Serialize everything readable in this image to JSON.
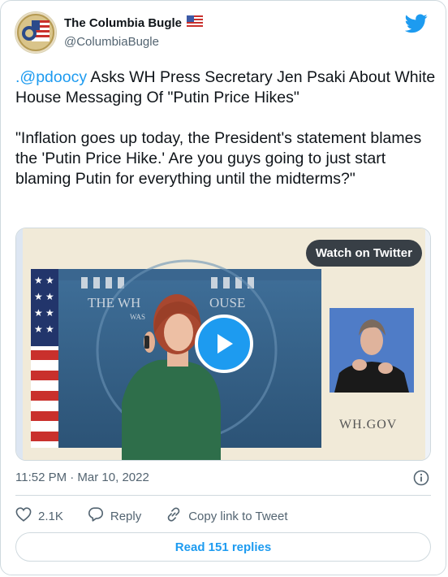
{
  "author": {
    "name": "The Columbia Bugle",
    "flag_icon": "us-flag-icon",
    "handle": "@ColumbiaBugle",
    "avatar_icon": "columbia-bugle-logo"
  },
  "brand_icon": "twitter-bird-icon",
  "tweet": {
    "mention": ".@pdoocy",
    "line1_rest": " Asks WH Press Secretary Jen Psaki About White House Messaging Of \"Putin Price Hikes\"",
    "quote": "\"Inflation goes up today, the President's statement blames the 'Putin Price Hike.' Are you guys going to just start blaming Putin for everything until the midterms?\""
  },
  "media": {
    "watch_label": "Watch on Twitter",
    "backdrop_text": "THE WH",
    "backdrop_text2": "OUSE",
    "backdrop_small": "WAS",
    "inset_text": "WH.GOV",
    "play_icon": "play-icon"
  },
  "meta": {
    "timestamp": "11:52 PM · Mar 10, 2022",
    "info_icon": "info-icon"
  },
  "actions": {
    "like_count": "2.1K",
    "reply_label": "Reply",
    "copy_label": "Copy link to Tweet"
  },
  "read_replies_label": "Read 151 replies",
  "colors": {
    "accent": "#1d9bf0",
    "text": "#0f1419",
    "muted": "#536471",
    "border": "#cfd9de"
  }
}
